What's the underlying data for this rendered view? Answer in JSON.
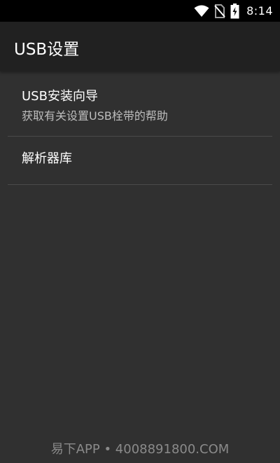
{
  "status_bar": {
    "time": "8:14",
    "icons": [
      "wifi-icon",
      "no-sim-icon",
      "battery-charging-icon"
    ]
  },
  "app_bar": {
    "title": "USB设置"
  },
  "preferences": [
    {
      "title": "USB安装向导",
      "summary": "获取有关设置USB栓带的帮助"
    },
    {
      "title": "解析器库"
    }
  ],
  "watermark": {
    "text": "易下APP • 4008891800.COM"
  },
  "colors": {
    "background": "#303030",
    "app_bar": "#212121",
    "status_bar": "#000000",
    "divider": "#4a4a4a"
  }
}
